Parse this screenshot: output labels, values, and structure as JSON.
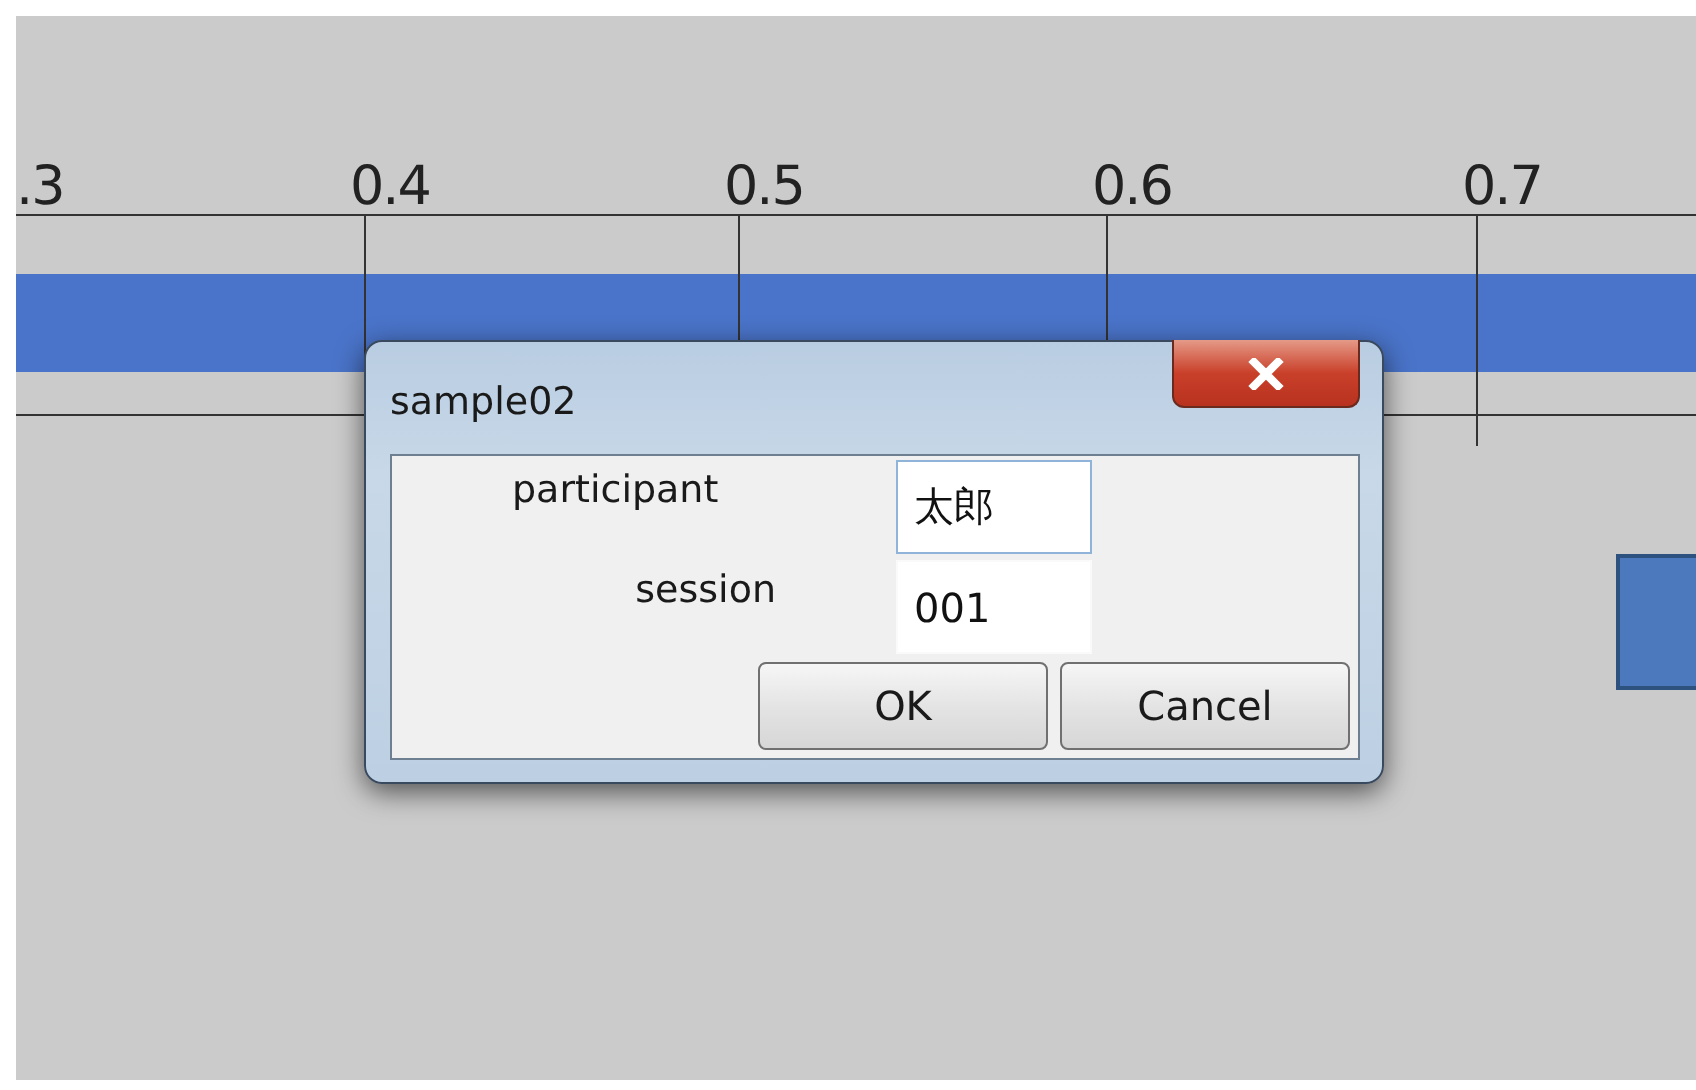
{
  "ruler": {
    "labels": [
      ".3",
      "0.4",
      "0.5",
      "0.6",
      "0.7"
    ]
  },
  "dialog": {
    "title": "sample02",
    "fields": [
      {
        "label": "participant",
        "value": "太郎",
        "focused": true
      },
      {
        "label": "session",
        "value": "001",
        "focused": false
      }
    ],
    "buttons": [
      "OK",
      "Cancel"
    ]
  }
}
